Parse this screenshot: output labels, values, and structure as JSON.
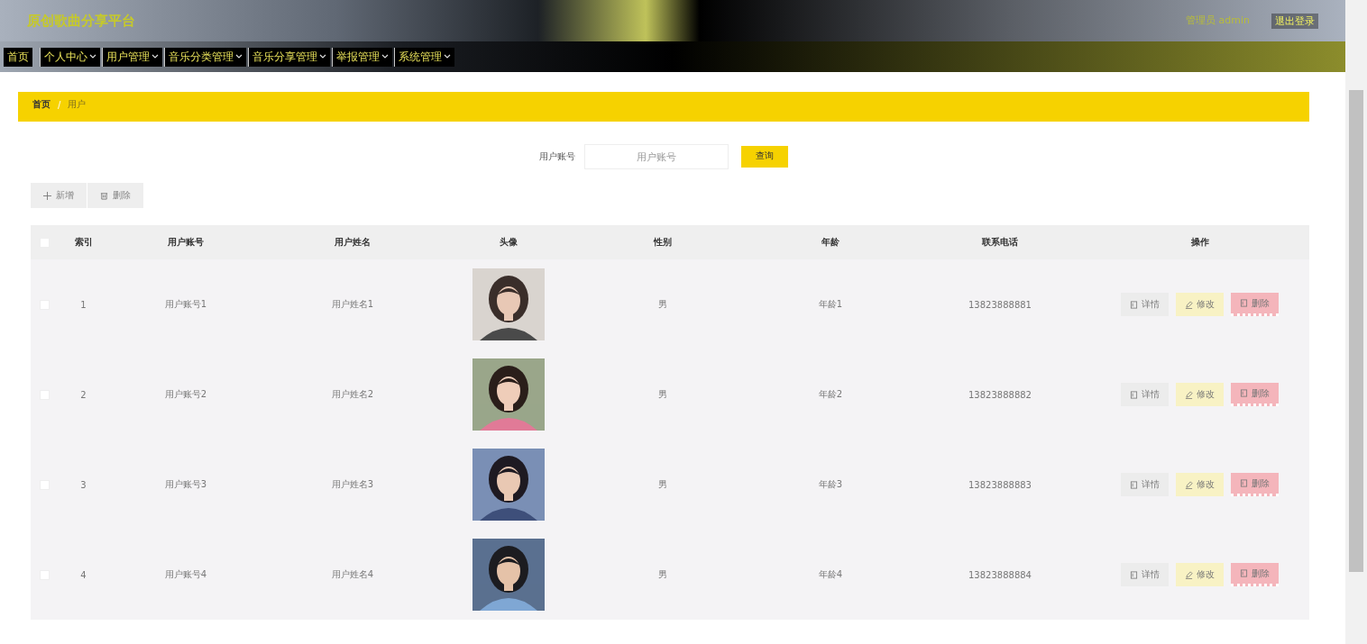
{
  "header": {
    "title": "原创歌曲分享平台",
    "user": "管理员 admin",
    "logout": "退出登录"
  },
  "nav": [
    {
      "label": "首页",
      "dropdown": false
    },
    {
      "label": "个人中心",
      "dropdown": true
    },
    {
      "label": "用户管理",
      "dropdown": true
    },
    {
      "label": "音乐分类管理",
      "dropdown": true
    },
    {
      "label": "音乐分享管理",
      "dropdown": true
    },
    {
      "label": "举报管理",
      "dropdown": true
    },
    {
      "label": "系统管理",
      "dropdown": true
    }
  ],
  "breadcrumb": [
    {
      "kind": "link",
      "text": "首页"
    },
    {
      "kind": "separator",
      "text": "/"
    },
    {
      "kind": "current",
      "text": "用户"
    }
  ],
  "search": {
    "label": "用户账号",
    "placeholder": "用户账号",
    "button": "查询"
  },
  "actions": {
    "add": "新增",
    "delete": "删除"
  },
  "table": {
    "select_all_checked": false,
    "columns": [
      "索引",
      "用户账号",
      "用户姓名",
      "头像",
      "性别",
      "年龄",
      "联系电话",
      "操作"
    ],
    "rows": [
      {
        "checked": false,
        "cells": [
          "1",
          "用户账号1",
          "用户姓名1",
          "",
          "男",
          "年龄1",
          "13823888881"
        ],
        "avatar": {
          "kind": "picture"
        },
        "buttons": [
          "详情",
          "修改",
          "删除"
        ]
      },
      {
        "checked": false,
        "cells": [
          "2",
          "用户账号2",
          "用户姓名2",
          "",
          "男",
          "年龄2",
          "13823888882"
        ],
        "avatar": {
          "kind": "picture"
        },
        "buttons": [
          "详情",
          "修改",
          "删除"
        ]
      },
      {
        "checked": false,
        "cells": [
          "3",
          "用户账号3",
          "用户姓名3",
          "",
          "男",
          "年龄3",
          "13823888883"
        ],
        "avatar": {
          "kind": "picture"
        },
        "buttons": [
          "详情",
          "修改",
          "删除"
        ]
      },
      {
        "checked": false,
        "cells": [
          "4",
          "用户账号4",
          "用户姓名4",
          "",
          "男",
          "年龄4",
          "13823888884"
        ],
        "avatar": {
          "kind": "picture"
        },
        "buttons": [
          "详情",
          "修改",
          "删除"
        ]
      }
    ]
  }
}
